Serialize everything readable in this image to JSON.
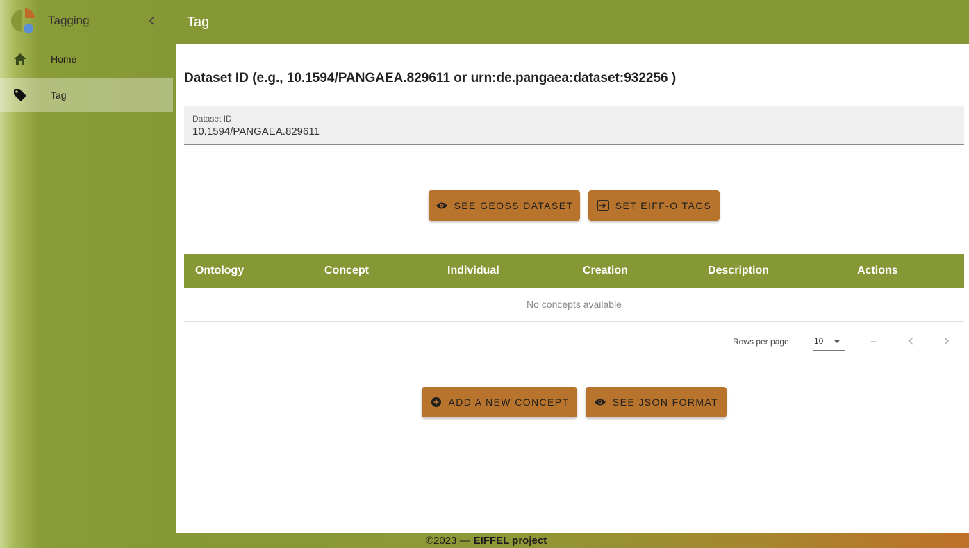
{
  "app": {
    "title": "Tagging",
    "brand_colors": {
      "green": "#869835",
      "orange": "#b8732c",
      "blue": "#5b8ed4"
    }
  },
  "sidebar": {
    "collapse_icon": "chevron-left-icon",
    "items": [
      {
        "label": "Home",
        "icon": "home-icon",
        "active": false
      },
      {
        "label": "Tag",
        "icon": "tag-icon",
        "active": true
      }
    ]
  },
  "header": {
    "title": "Tag"
  },
  "main": {
    "heading": "Dataset ID (e.g., 10.1594/PANGAEA.829611 or urn:de.pangaea:dataset:932256 )",
    "dataset_field": {
      "label": "Dataset ID",
      "value": "10.1594/PANGAEA.829611"
    },
    "buttons": {
      "see_geoss": "SEE GEOSS DATASET",
      "set_tags": "SET EIFF-O TAGS",
      "add_concept": "ADD A NEW CONCEPT",
      "see_json": "SEE JSON FORMAT"
    },
    "table": {
      "columns": [
        "Ontology",
        "Concept",
        "Individual",
        "Creation",
        "Description",
        "Actions"
      ],
      "empty_text": "No concepts available"
    },
    "pagination": {
      "rows_per_page_label": "Rows per page:",
      "rows_per_page": "10",
      "range_text": "–"
    }
  },
  "footer": {
    "year_text": "©2023 —",
    "project": "EIFFEL project"
  }
}
